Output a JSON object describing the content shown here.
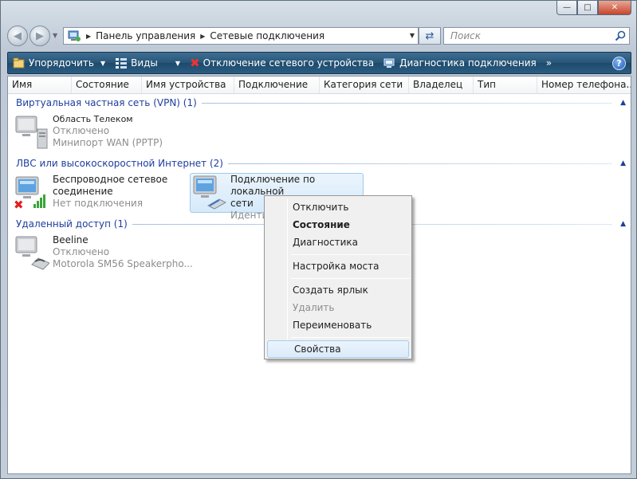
{
  "window": {
    "controls": {
      "minimize": "—",
      "maximize": "□",
      "close": "✕"
    }
  },
  "nav": {
    "breadcrumbs": [
      "Панель управления",
      "Сетевые подключения"
    ],
    "search_placeholder": "Поиск"
  },
  "toolbar": {
    "organize": "Упорядочить",
    "views": "Виды",
    "disconnect": "Отключение сетевого устройства",
    "diagnose": "Диагностика подключения",
    "more": "»",
    "help": "?"
  },
  "columns": [
    "Имя",
    "Состояние",
    "Имя устройства",
    "Подключение",
    "Категория сети",
    "Владелец",
    "Тип",
    "Номер телефона..."
  ],
  "groups": [
    {
      "title": "Виртуальная частная сеть (VPN) (1)",
      "items": [
        {
          "name": "Область Телеком",
          "status": "Отключено",
          "device": "Минипорт WAN (PPTP)"
        }
      ]
    },
    {
      "title": "ЛВС или высокоскоростной Интернет (2)",
      "items": [
        {
          "name1": "Беспроводное сетевое",
          "name2": "соединение",
          "status": "Нет подключения"
        },
        {
          "name1": "Подключение по локальной",
          "name2": "сети",
          "status": "Идентиф"
        }
      ]
    },
    {
      "title": "Удаленный доступ (1)",
      "items": [
        {
          "name": "Beeline",
          "status": "Отключено",
          "device": "Motorola SM56 Speakerpho..."
        }
      ]
    }
  ],
  "context_menu": {
    "disconnect": "Отключить",
    "status": "Состояние",
    "diagnose": "Диагностика",
    "bridge": "Настройка моста",
    "shortcut": "Создать ярлык",
    "delete": "Удалить",
    "rename": "Переименовать",
    "properties": "Свойства"
  }
}
